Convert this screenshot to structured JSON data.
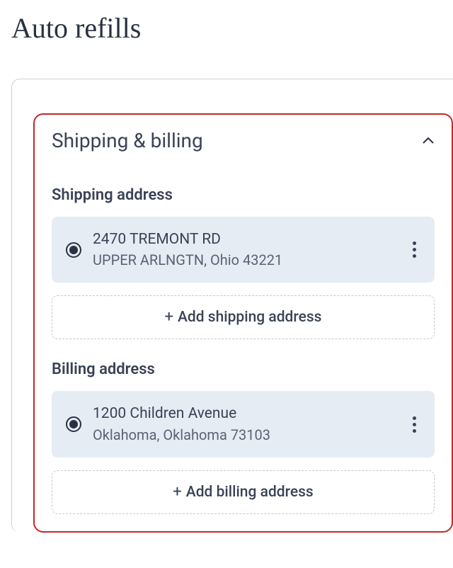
{
  "page": {
    "title": "Auto refills"
  },
  "section": {
    "title": "Shipping & billing"
  },
  "shipping": {
    "title": "Shipping address",
    "address": {
      "line1": "2470 TREMONT RD",
      "line2": "UPPER ARLNGTN, Ohio 43221"
    },
    "add_label": "Add shipping address"
  },
  "billing": {
    "title": "Billing address",
    "address": {
      "line1": "1200 Children Avenue",
      "line2": "Oklahoma, Oklahoma 73103"
    },
    "add_label": "Add billing address"
  }
}
